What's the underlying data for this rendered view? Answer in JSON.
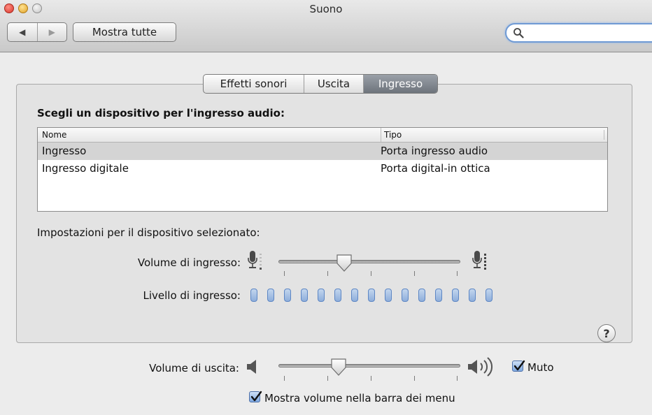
{
  "window": {
    "title": "Suono"
  },
  "toolbar": {
    "back_glyph": "◀",
    "forward_glyph": "▶",
    "show_all_label": "Mostra tutte",
    "search_placeholder": "",
    "search_icon": "search-icon"
  },
  "tabs": [
    {
      "label": "Effetti sonori",
      "selected": false
    },
    {
      "label": "Uscita",
      "selected": false
    },
    {
      "label": "Ingresso",
      "selected": true
    }
  ],
  "input": {
    "section_title": "Scegli un dispositivo per l'ingresso audio:",
    "table": {
      "columns": [
        "Nome",
        "Tipo"
      ],
      "rows": [
        {
          "name": "Ingresso",
          "type": "Porta ingresso audio",
          "selected": true
        },
        {
          "name": "Ingresso digitale",
          "type": "Porta digital-in ottica",
          "selected": false
        }
      ]
    },
    "settings_title": "Impostazioni per il dispositivo selezionato:",
    "input_volume_label": "Volume di ingresso:",
    "input_volume_fraction": 0.36,
    "input_level_label": "Livello di ingresso:",
    "input_level_segments": 15,
    "input_level_active": 0,
    "help_label": "?"
  },
  "output": {
    "volume_label": "Volume di uscita:",
    "volume_fraction": 0.33,
    "mute_label": "Muto",
    "mute_checked": true,
    "show_volume_label": "Mostra volume nella barra dei menu",
    "show_volume_checked": true
  },
  "colors": {
    "selected_tab": "#7a8088",
    "level_segment": "#8eaedb",
    "checkbox_blue": "#7ea8e0",
    "search_focus": "#6f9ad4"
  }
}
